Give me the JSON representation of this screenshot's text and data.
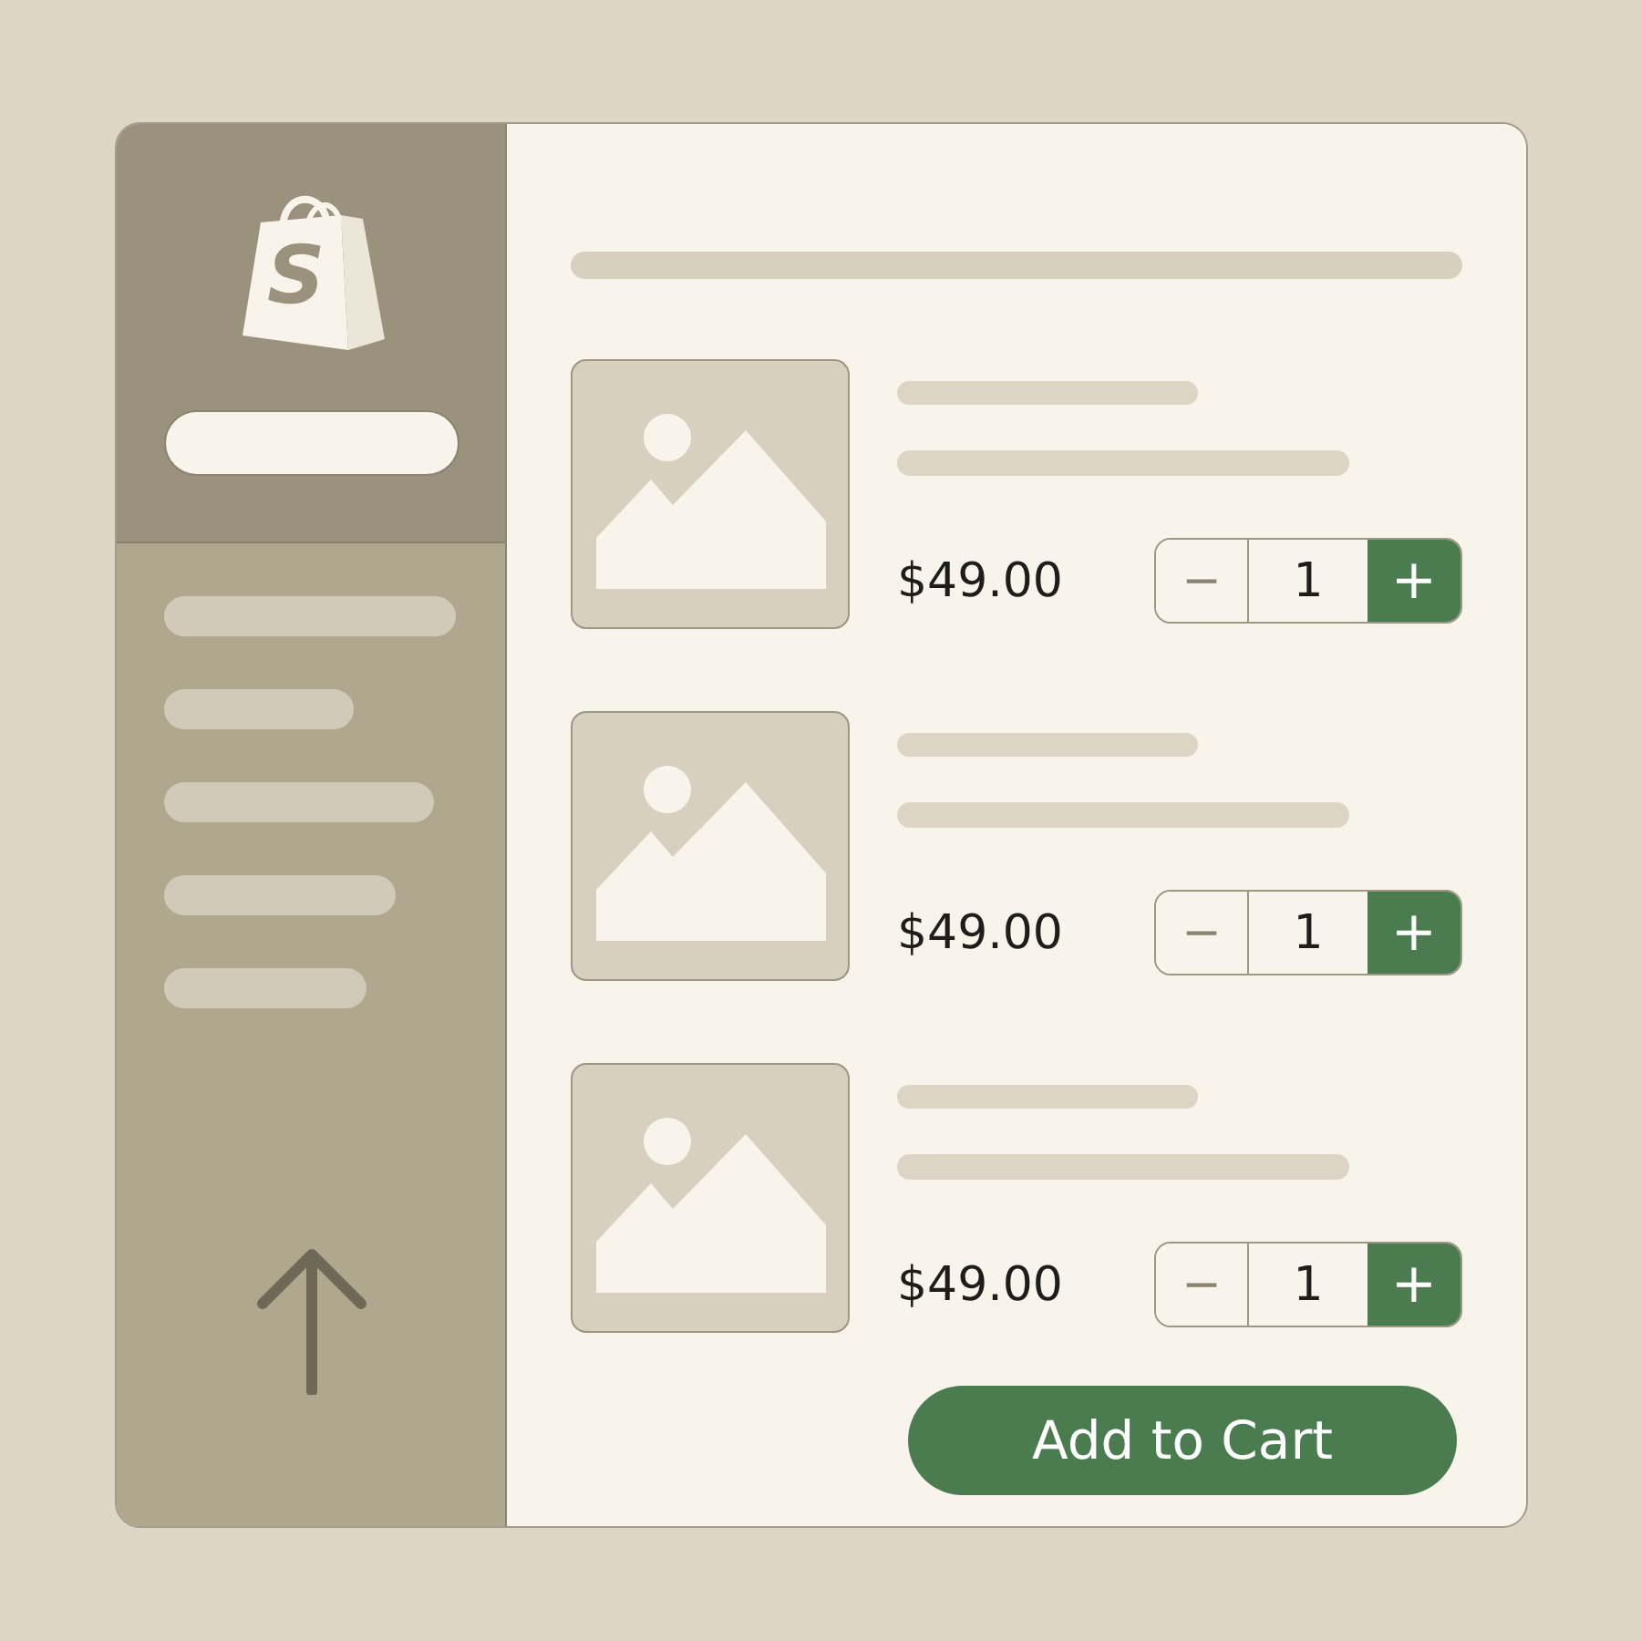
{
  "sidebar": {
    "logo_letter": "S"
  },
  "products": [
    {
      "price": "$49.00",
      "quantity": "1",
      "decrement": "−",
      "increment": "+"
    },
    {
      "price": "$49.00",
      "quantity": "1",
      "decrement": "−",
      "increment": "+"
    },
    {
      "price": "$49.00",
      "quantity": "1",
      "decrement": "−",
      "increment": "+"
    }
  ],
  "add_to_cart": "Add to Cart"
}
